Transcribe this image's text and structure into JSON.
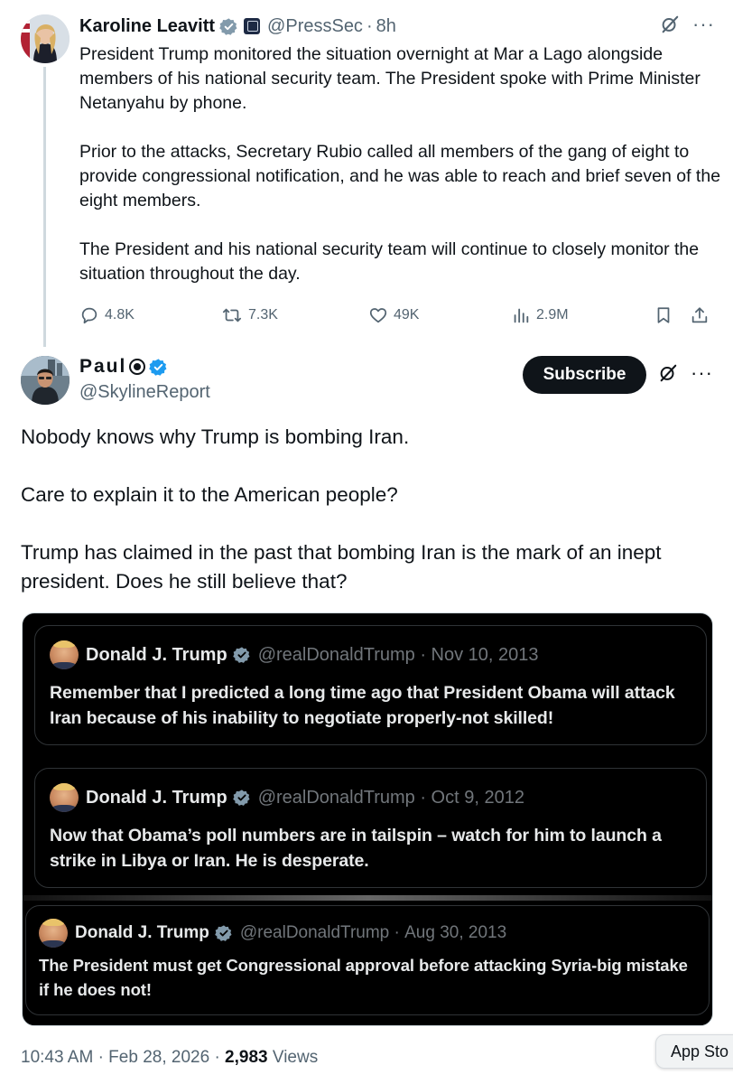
{
  "parent_tweet": {
    "name": "Karoline Leavitt",
    "handle": "@PressSec",
    "time": "8h",
    "text": "President Trump monitored the situation overnight at Mar a Lago alongside members of his national security team. The President spoke with Prime Minister Netanyahu by phone.\n\nPrior to the attacks, Secretary Rubio called all members of the gang of eight to provide congressional notification, and he was able to reach and brief seven of the eight members.\n\nThe President and his national security team will continue to closely monitor the situation throughout the day.",
    "replies": "4.8K",
    "reposts": "7.3K",
    "likes": "49K",
    "views": "2.9M"
  },
  "main_tweet": {
    "name": "Paul",
    "handle": "@SkylineReport",
    "subscribe_label": "Subscribe",
    "text": "Nobody knows why Trump is bombing Iran.\n\nCare to explain it to the American people?\n\nTrump has claimed in the past that bombing Iran is the mark of an inept president. Does he still believe that?",
    "footer_time": "10:43 AM",
    "footer_date": "Feb 28, 2026",
    "footer_views_count": "2,983",
    "footer_views_label": "Views"
  },
  "embedded_tweets": [
    {
      "name": "Donald J. Trump",
      "handle": "@realDonaldTrump",
      "date": "Nov 10, 2013",
      "text": "Remember that I predicted a long time ago that President Obama will attack Iran because of his inability to negotiate properly-not skilled!"
    },
    {
      "name": "Donald J. Trump",
      "handle": "@realDonaldTrump",
      "date": "Oct 9, 2012",
      "text": "Now that Obama’s poll numbers are in tailspin – watch for him to launch a strike in Libya or Iran.  He is desperate."
    },
    {
      "name": "Donald J. Trump",
      "handle": "@realDonaldTrump",
      "date": "Aug 30, 2013",
      "text": "The President must get Congressional approval before attacking Syria-big mistake if he does not!"
    }
  ],
  "app_store_label": "App Sto",
  "colors": {
    "verified_blue": "#1d9bf0",
    "text_secondary": "#536471",
    "dark_card_bg": "#000000"
  }
}
